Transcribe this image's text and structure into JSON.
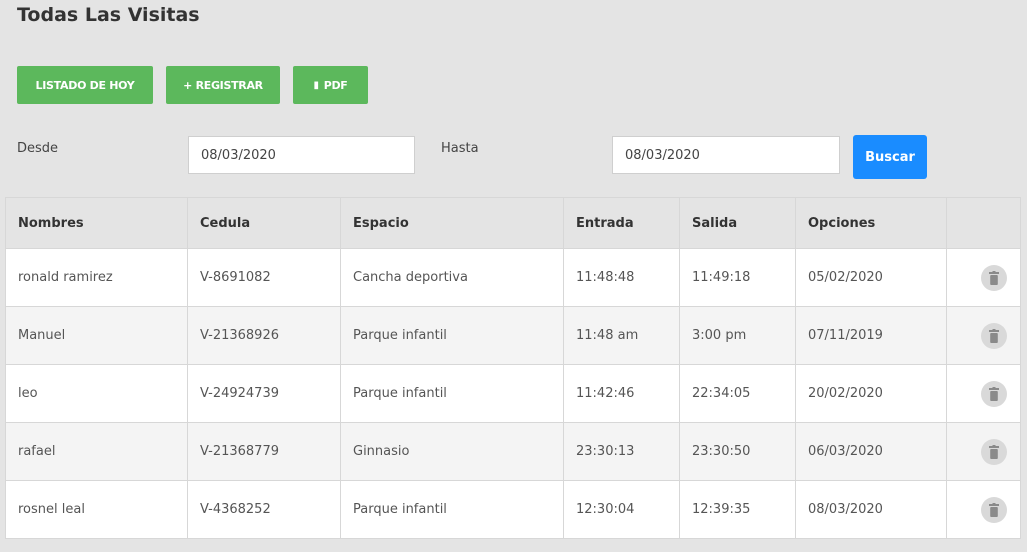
{
  "page": {
    "title": "Todas Las Visitas"
  },
  "toolbar": {
    "today_label": "LISTADO DE HOY",
    "register_label": "+ REGISTRAR",
    "pdf_label": "PDF",
    "pdf_icon": "file-icon"
  },
  "filters": {
    "from_label": "Desde",
    "from_value": "08/03/2020",
    "to_label": "Hasta",
    "to_value": "08/03/2020",
    "search_label": "Buscar"
  },
  "table": {
    "headers": [
      "Nombres",
      "Cedula",
      "Espacio",
      "Entrada",
      "Salida",
      "Opciones",
      ""
    ],
    "rows": [
      {
        "nombre": "ronald ramirez",
        "cedula": "V-8691082",
        "espacio": "Cancha deportiva",
        "entrada": "11:48:48",
        "salida": "11:49:18",
        "fecha": "05/02/2020"
      },
      {
        "nombre": "Manuel",
        "cedula": "V-21368926",
        "espacio": "Parque infantil",
        "entrada": "11:48 am",
        "salida": "3:00 pm",
        "fecha": "07/11/2019"
      },
      {
        "nombre": "leo",
        "cedula": "V-24924739",
        "espacio": "Parque infantil",
        "entrada": "11:42:46",
        "salida": "22:34:05",
        "fecha": "20/02/2020"
      },
      {
        "nombre": "rafael",
        "cedula": "V-21368779",
        "espacio": "Ginnasio",
        "entrada": "23:30:13",
        "salida": "23:30:50",
        "fecha": "06/03/2020"
      },
      {
        "nombre": "rosnel leal",
        "cedula": "V-4368252",
        "espacio": "Parque infantil",
        "entrada": "12:30:04",
        "salida": "12:39:35",
        "fecha": "08/03/2020"
      }
    ],
    "delete_icon": "trash-icon"
  },
  "colors": {
    "green": "#5cb85c",
    "blue": "#1a8cff",
    "background": "#e4e4e4"
  }
}
